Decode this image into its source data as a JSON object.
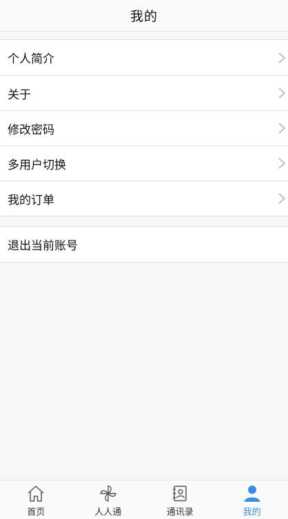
{
  "header": {
    "title": "我的"
  },
  "menu_group_1": [
    {
      "label": "个人简介"
    },
    {
      "label": "关于"
    },
    {
      "label": "修改密码"
    },
    {
      "label": "多用户切换"
    },
    {
      "label": "我的订单"
    }
  ],
  "menu_group_2": [
    {
      "label": "退出当前账号"
    }
  ],
  "tabbar": {
    "active_color": "#3a8de4",
    "tabs": [
      {
        "label": "首页",
        "icon": "home-icon"
      },
      {
        "label": "人人通",
        "icon": "pinwheel-icon"
      },
      {
        "label": "通讯录",
        "icon": "contacts-book-icon"
      },
      {
        "label": "我的",
        "icon": "user-icon",
        "active": true
      }
    ]
  }
}
